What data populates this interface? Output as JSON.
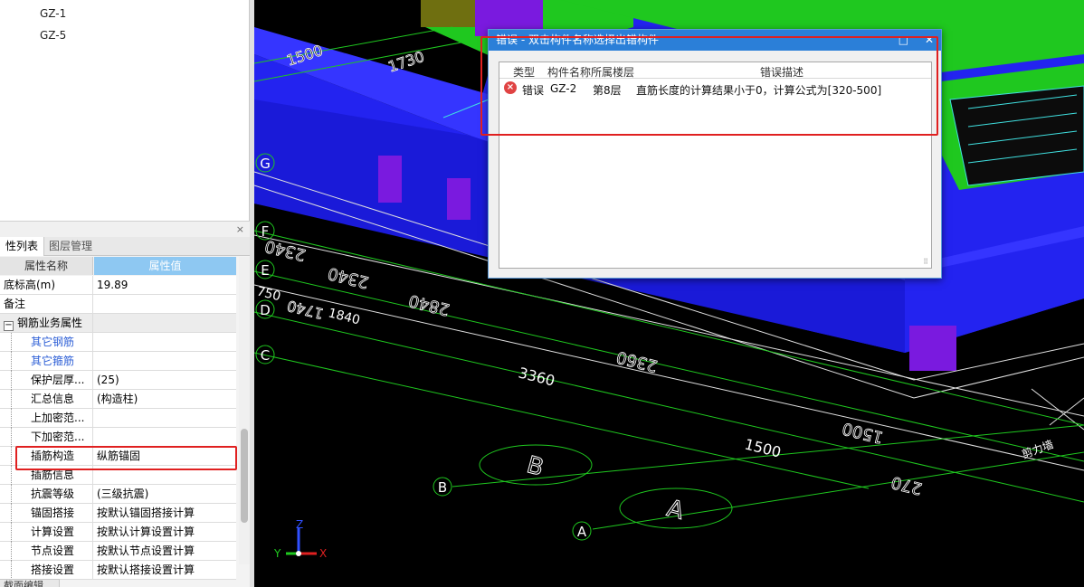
{
  "tree": {
    "items": [
      "GZ-1",
      "GZ-5"
    ]
  },
  "panel": {
    "close_glyph": "×",
    "tabs": [
      "性列表",
      "图层管理"
    ],
    "headers": {
      "name": "属性名称",
      "value": "属性值"
    },
    "rows": [
      {
        "name": "底标高(m)",
        "value": "19.89"
      },
      {
        "name": "备注",
        "value": ""
      },
      {
        "name": "钢筋业务属性",
        "value": ""
      },
      {
        "name": "其它钢筋",
        "value": ""
      },
      {
        "name": "其它箍筋",
        "value": ""
      },
      {
        "name": "保护层厚...",
        "value": "(25)"
      },
      {
        "name": "汇总信息",
        "value": "(构造柱)"
      },
      {
        "name": "上加密范...",
        "value": ""
      },
      {
        "name": "下加密范...",
        "value": ""
      },
      {
        "name": "插筋构造",
        "value": "纵筋锚固"
      },
      {
        "name": "插筋信息",
        "value": ""
      },
      {
        "name": "抗震等级",
        "value": "(三级抗震)"
      },
      {
        "name": "锚固搭接",
        "value": "按默认锚固搭接计算"
      },
      {
        "name": "计算设置",
        "value": "按默认计算设置计算"
      },
      {
        "name": "节点设置",
        "value": "按默认节点设置计算"
      },
      {
        "name": "搭接设置",
        "value": "按默认搭接设置计算"
      }
    ],
    "bottom_tab": "截面编辑"
  },
  "cad": {
    "axis_labels": [
      "G",
      "F",
      "E",
      "D",
      "C",
      "B",
      "A"
    ],
    "dims": [
      "3360",
      "1500",
      "2360",
      "1500",
      "2340",
      "2340",
      "2840",
      "750",
      "1840",
      "1740",
      "1500",
      "1730",
      "270"
    ],
    "grid_bubbles": [
      "B",
      "A"
    ],
    "axes": {
      "x": "X",
      "y": "Y",
      "z": "Z"
    },
    "edge_text": "剪力墙"
  },
  "dialog": {
    "title": "错误 - 双击构件名称选择出错构件",
    "btn_restore": "□",
    "btn_close": "✕",
    "columns": [
      "类型",
      "构件名称",
      "所属楼层",
      "错误描述"
    ],
    "row": {
      "icon": "error-icon",
      "type": "错误",
      "name": "GZ-2",
      "floor": "第8层",
      "desc": "直筋长度的计算结果小于0，计算公式为[320-500]"
    }
  },
  "colors": {
    "wall_blue": "#2323f0",
    "slab_green": "#1fc81f",
    "column_purple": "#7a1adf",
    "highlight_red": "#e02020",
    "dialog_title": "#2b7fd8"
  }
}
